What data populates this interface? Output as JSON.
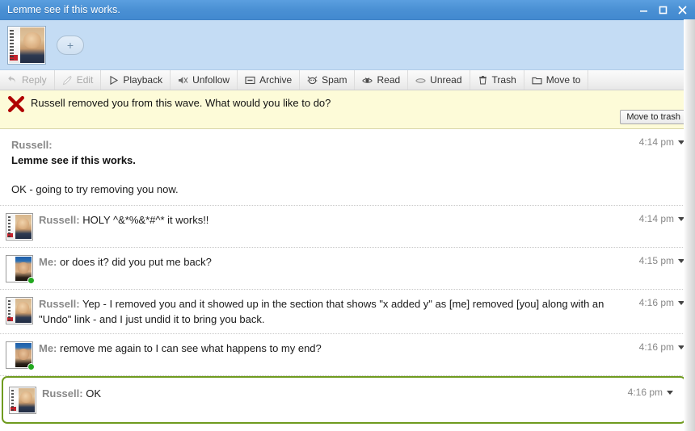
{
  "window": {
    "title": "Lemme see if this works.",
    "controls": [
      {
        "name": "minimize",
        "glyph": "–"
      },
      {
        "name": "maximize",
        "glyph": "□"
      },
      {
        "name": "close",
        "glyph": "✕"
      }
    ]
  },
  "participants": {
    "add_label": "+",
    "people": [
      {
        "name": "Russell",
        "avatar": "russell-avatar"
      }
    ]
  },
  "toolbar": {
    "items": [
      {
        "label": "Reply",
        "icon": "reply-icon",
        "disabled": true
      },
      {
        "label": "Edit",
        "icon": "pencil-icon",
        "disabled": true
      },
      {
        "label": "Playback",
        "icon": "play-icon",
        "disabled": false
      },
      {
        "label": "Unfollow",
        "icon": "mute-icon",
        "disabled": false
      },
      {
        "label": "Archive",
        "icon": "archive-icon",
        "disabled": false
      },
      {
        "label": "Spam",
        "icon": "spam-icon",
        "disabled": false
      },
      {
        "label": "Read",
        "icon": "eye-open-icon",
        "disabled": false
      },
      {
        "label": "Unread",
        "icon": "eye-closed-icon",
        "disabled": false
      },
      {
        "label": "Trash",
        "icon": "trash-icon",
        "disabled": false
      },
      {
        "label": "Move to",
        "icon": "folder-icon",
        "disabled": false
      }
    ]
  },
  "notice": {
    "icon": "red-x-icon",
    "text": "Russell removed you from this wave. What would you like to do?",
    "button_label": "Move to trash",
    "background": "#fdfbd8"
  },
  "thread": {
    "messages": [
      {
        "author": "Russell:",
        "subject": "Lemme see if this works.",
        "text": "OK - going to try removing you now.",
        "time": "4:14 pm",
        "avatar": "russell-avatar",
        "root": true,
        "online": false,
        "focused": false
      },
      {
        "author": "Russell:",
        "text": "HOLY ^&*%&*#^*  it works!!",
        "time": "4:14 pm",
        "avatar": "russell-avatar",
        "root": false,
        "online": false,
        "focused": false
      },
      {
        "author": "Me:",
        "text": "or does it? did you put me back?",
        "time": "4:15 pm",
        "avatar": "me-avatar",
        "root": false,
        "online": true,
        "focused": false
      },
      {
        "author": "Russell:",
        "text": "Yep - I removed you and it showed up in the section that shows \"x added y\" as [me] removed [you] along with an \"Undo\" link - and I just undid it to bring you back.",
        "time": "4:16 pm",
        "avatar": "russell-avatar",
        "root": false,
        "online": false,
        "focused": false
      },
      {
        "author": "Me:",
        "text": "remove me again to I can see what happens to my end?",
        "time": "4:16 pm",
        "avatar": "me-avatar",
        "root": false,
        "online": true,
        "focused": false
      },
      {
        "author": "Russell:",
        "text": "OK",
        "time": "4:16 pm",
        "avatar": "russell-avatar",
        "root": false,
        "online": false,
        "focused": true
      }
    ]
  },
  "colors": {
    "titlebar": "#4a90d4",
    "participants_bar": "#c4dcf4",
    "notice_bg": "#fdfbd8",
    "focus_border": "#6f9b1f",
    "online_dot": "#22a81f",
    "author_gray": "#888888"
  }
}
